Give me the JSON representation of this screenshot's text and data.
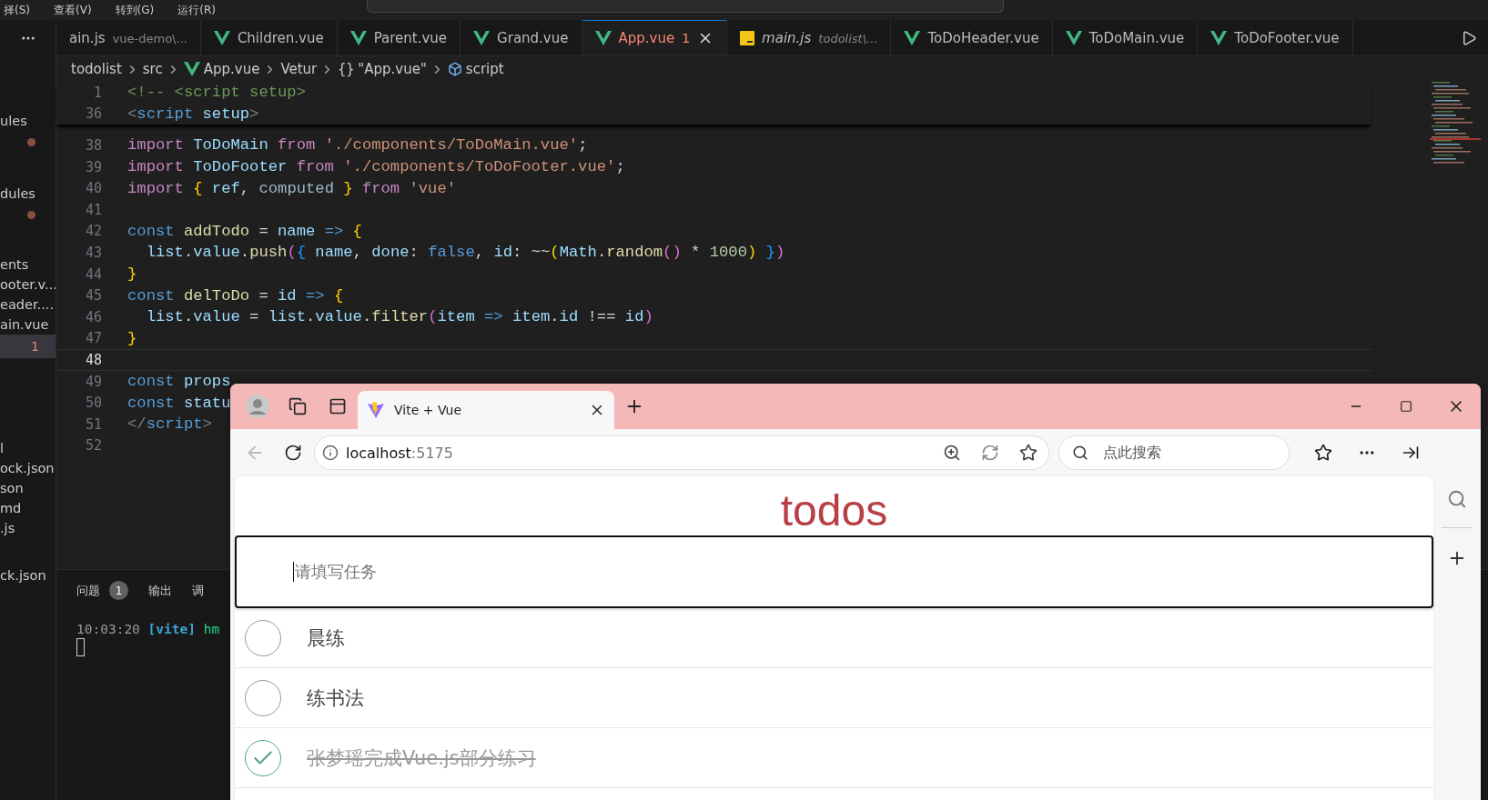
{
  "menu": [
    "择(S)",
    "查看(V)",
    "转到(G)",
    "运行(R)"
  ],
  "explorer": {
    "items": [
      {
        "kind": "text",
        "label": "ules"
      },
      {
        "kind": "dot"
      },
      {
        "kind": "text",
        "label": "dules"
      },
      {
        "kind": "dot"
      },
      {
        "kind": "text",
        "label": "ents"
      },
      {
        "kind": "text",
        "label": "ooter.v..."
      },
      {
        "kind": "text",
        "label": "eader...."
      },
      {
        "kind": "text",
        "label": "ain.vue"
      },
      {
        "kind": "badge",
        "label": "1"
      },
      {
        "kind": "text",
        "label": "l"
      },
      {
        "kind": "text",
        "label": "ock.json"
      },
      {
        "kind": "text",
        "label": "son"
      },
      {
        "kind": "text",
        "label": "md"
      },
      {
        "kind": "text",
        "label": ".js"
      },
      {
        "kind": "text",
        "label": "ck.json"
      }
    ]
  },
  "editor_tabs": [
    {
      "kind": "js",
      "label": "ain.js",
      "detail": "vue-demo\\...",
      "selected": false,
      "preview": false
    },
    {
      "kind": "vue",
      "label": "Children.vue",
      "selected": false,
      "preview": false
    },
    {
      "kind": "vue",
      "label": "Parent.vue",
      "selected": false,
      "preview": false
    },
    {
      "kind": "vue",
      "label": "Grand.vue",
      "selected": false,
      "preview": false
    },
    {
      "kind": "vue",
      "label": "App.vue",
      "problems": "1",
      "selected": true,
      "preview": false
    },
    {
      "kind": "js",
      "label": "main.js",
      "detail": "todolist\\...",
      "selected": false,
      "preview": true
    },
    {
      "kind": "vue",
      "label": "ToDoHeader.vue",
      "selected": false,
      "preview": false
    },
    {
      "kind": "vue",
      "label": "ToDoMain.vue",
      "selected": false,
      "preview": false
    },
    {
      "kind": "vue",
      "label": "ToDoFooter.vue",
      "selected": false,
      "preview": false
    }
  ],
  "breadcrumb": [
    {
      "kind": "folder",
      "label": "todolist"
    },
    {
      "kind": "folder",
      "label": "src"
    },
    {
      "kind": "vue",
      "label": "App.vue"
    },
    {
      "kind": "folder",
      "label": "Vetur"
    },
    {
      "kind": "braces",
      "icon": "{}",
      "label": "\"App.vue\""
    },
    {
      "kind": "module",
      "label": "script"
    }
  ],
  "code": {
    "sticky": [
      {
        "number": "1",
        "current": false,
        "tokens": [
          {
            "kind": "comment",
            "text": "<!-- <script setup>"
          }
        ]
      },
      {
        "number": "36",
        "current": false,
        "tokens": [
          {
            "kind": "punct",
            "text": "<"
          },
          {
            "kind": "tag",
            "text": "script"
          },
          {
            "kind": "var",
            "text": " setup"
          },
          {
            "kind": "punct",
            "text": ">"
          }
        ]
      }
    ],
    "lines": [
      {
        "number": "38",
        "current": false,
        "tokens": [
          {
            "kind": "keyword",
            "text": "import"
          },
          {
            "kind": "var",
            "text": " ToDoMain "
          },
          {
            "kind": "keyword",
            "text": "from"
          },
          {
            "kind": "string",
            "text": " './components/ToDoMain.vue'"
          },
          {
            "kind": "plain",
            "text": ";"
          }
        ]
      },
      {
        "number": "39",
        "current": false,
        "tokens": [
          {
            "kind": "keyword",
            "text": "import"
          },
          {
            "kind": "var",
            "text": " ToDoFooter "
          },
          {
            "kind": "keyword",
            "text": "from"
          },
          {
            "kind": "string",
            "text": " './components/ToDoFooter.vue'"
          },
          {
            "kind": "plain",
            "text": ";"
          }
        ]
      },
      {
        "number": "40",
        "current": false,
        "tokens": [
          {
            "kind": "keyword",
            "text": "import"
          },
          {
            "kind": "bracket1",
            "text": " {"
          },
          {
            "kind": "var",
            "text": " ref"
          },
          {
            "kind": "plain",
            "text": ", "
          },
          {
            "kind": "muted",
            "text": "computed"
          },
          {
            "kind": "bracket1",
            "text": " }"
          },
          {
            "kind": "keyword",
            "text": " from"
          },
          {
            "kind": "string",
            "text": " 'vue'"
          }
        ]
      },
      {
        "number": "41",
        "current": false
      },
      {
        "number": "42",
        "current": false,
        "tokens": [
          {
            "kind": "storage",
            "text": "const"
          },
          {
            "kind": "func",
            "text": " addTodo"
          },
          {
            "kind": "plain",
            "text": " = "
          },
          {
            "kind": "var",
            "text": "name"
          },
          {
            "kind": "storage",
            "text": " =>"
          },
          {
            "kind": "bracket1",
            "text": " {"
          }
        ]
      },
      {
        "number": "43",
        "current": false,
        "tokens": [
          {
            "kind": "var",
            "text": "  list"
          },
          {
            "kind": "plain",
            "text": "."
          },
          {
            "kind": "var",
            "text": "value"
          },
          {
            "kind": "plain",
            "text": "."
          },
          {
            "kind": "func",
            "text": "push"
          },
          {
            "kind": "bracket2",
            "text": "("
          },
          {
            "kind": "bracket3",
            "text": "{"
          },
          {
            "kind": "var",
            "text": " name"
          },
          {
            "kind": "plain",
            "text": ", "
          },
          {
            "kind": "var",
            "text": "done"
          },
          {
            "kind": "plain",
            "text": ": "
          },
          {
            "kind": "storage",
            "text": "false"
          },
          {
            "kind": "plain",
            "text": ", "
          },
          {
            "kind": "var",
            "text": "id"
          },
          {
            "kind": "plain",
            "text": ": ~~"
          },
          {
            "kind": "bracket1",
            "text": "("
          },
          {
            "kind": "var",
            "text": "Math"
          },
          {
            "kind": "plain",
            "text": "."
          },
          {
            "kind": "func",
            "text": "random"
          },
          {
            "kind": "bracket2",
            "text": "()"
          },
          {
            "kind": "plain",
            "text": " * "
          },
          {
            "kind": "number",
            "text": "1000"
          },
          {
            "kind": "bracket1",
            "text": ")"
          },
          {
            "kind": "bracket3",
            "text": " }"
          },
          {
            "kind": "bracket2",
            "text": ")"
          }
        ]
      },
      {
        "number": "44",
        "current": false,
        "tokens": [
          {
            "kind": "bracket1",
            "text": "}"
          }
        ]
      },
      {
        "number": "45",
        "current": false,
        "tokens": [
          {
            "kind": "storage",
            "text": "const"
          },
          {
            "kind": "func",
            "text": " delToDo"
          },
          {
            "kind": "plain",
            "text": " = "
          },
          {
            "kind": "var",
            "text": "id"
          },
          {
            "kind": "storage",
            "text": " =>"
          },
          {
            "kind": "bracket1",
            "text": " {"
          }
        ]
      },
      {
        "number": "46",
        "current": false,
        "tokens": [
          {
            "kind": "var",
            "text": "  list"
          },
          {
            "kind": "plain",
            "text": "."
          },
          {
            "kind": "var",
            "text": "value"
          },
          {
            "kind": "plain",
            "text": " = "
          },
          {
            "kind": "var",
            "text": "list"
          },
          {
            "kind": "plain",
            "text": "."
          },
          {
            "kind": "var",
            "text": "value"
          },
          {
            "kind": "plain",
            "text": "."
          },
          {
            "kind": "func",
            "text": "filter"
          },
          {
            "kind": "bracket2",
            "text": "("
          },
          {
            "kind": "var",
            "text": "item"
          },
          {
            "kind": "storage",
            "text": " =>"
          },
          {
            "kind": "var",
            "text": " item"
          },
          {
            "kind": "plain",
            "text": "."
          },
          {
            "kind": "var",
            "text": "id"
          },
          {
            "kind": "plain",
            "text": " !== "
          },
          {
            "kind": "var",
            "text": "id"
          },
          {
            "kind": "bracket2",
            "text": ")"
          }
        ]
      },
      {
        "number": "47",
        "current": false,
        "tokens": [
          {
            "kind": "bracket1",
            "text": "}"
          }
        ]
      },
      {
        "number": "48",
        "current": true
      },
      {
        "number": "49",
        "current": false,
        "tokens": [
          {
            "kind": "storage",
            "text": "const"
          },
          {
            "kind": "var",
            "text": " props"
          }
        ]
      },
      {
        "number": "50",
        "current": false,
        "tokens": [
          {
            "kind": "storage",
            "text": "const"
          },
          {
            "kind": "var",
            "text": " statu"
          }
        ]
      },
      {
        "number": "51",
        "current": false,
        "tokens": [
          {
            "kind": "punct",
            "text": "</"
          },
          {
            "kind": "tag",
            "text": "script"
          },
          {
            "kind": "punct",
            "text": ">"
          }
        ]
      },
      {
        "number": "52",
        "current": false
      }
    ]
  },
  "panel": {
    "tabs": [
      {
        "label": "问题",
        "badge": "1"
      },
      {
        "label": "输出"
      },
      {
        "label": "调"
      }
    ],
    "terminal": {
      "time": "10:03:20",
      "tag": "[vite]",
      "text": "hm"
    }
  },
  "browser": {
    "tab": {
      "title": "Vite + Vue"
    },
    "back": {
      "disabled": true
    },
    "address": {
      "host": "localhost",
      "port": ":5175"
    },
    "search": {
      "placeholder": "点此搜索"
    },
    "page": {
      "title": "todos",
      "input": {
        "placeholder": "请填写任务"
      },
      "todos": [
        {
          "label": "晨练",
          "done": false
        },
        {
          "label": "练书法",
          "done": false
        },
        {
          "label": "张梦瑶完成Vue.js部分练习",
          "done": true
        }
      ]
    }
  }
}
